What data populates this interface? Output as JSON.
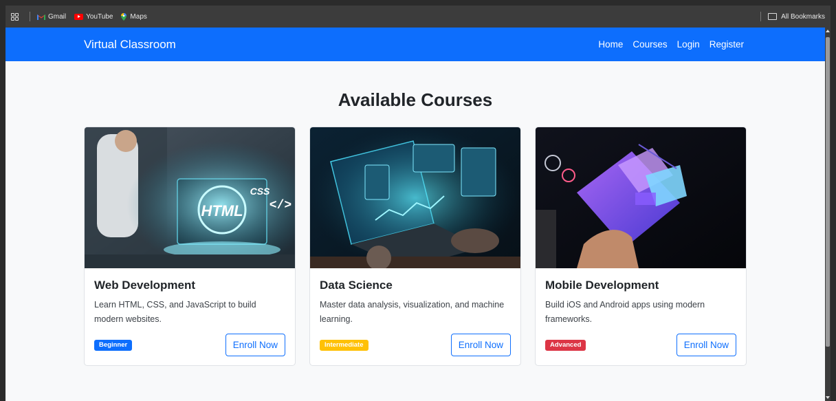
{
  "bookmarks": {
    "items": [
      {
        "label": "Gmail",
        "icon": "gmail-icon"
      },
      {
        "label": "YouTube",
        "icon": "youtube-icon"
      },
      {
        "label": "Maps",
        "icon": "maps-icon"
      }
    ],
    "all_bookmarks": "All Bookmarks"
  },
  "navbar": {
    "brand": "Virtual Classroom",
    "links": [
      "Home",
      "Courses",
      "Login",
      "Register"
    ],
    "color": "#0d6efd"
  },
  "main": {
    "title": "Available Courses",
    "courses": [
      {
        "title": "Web Development",
        "description": "Learn HTML, CSS, and JavaScript to build modern websites.",
        "level": "Beginner",
        "level_color": "#0d6efd",
        "button": "Enroll Now",
        "image": "laptop with HTML and CSS holograms"
      },
      {
        "title": "Data Science",
        "description": "Master data analysis, visualization, and machine learning.",
        "level": "Intermediate",
        "level_color": "#ffc107",
        "button": "Enroll Now",
        "image": "laptop with holographic data dashboards"
      },
      {
        "title": "Mobile Development",
        "description": "Build iOS and Android apps using modern frameworks.",
        "level": "Advanced",
        "level_color": "#dc3545",
        "button": "Enroll Now",
        "image": "hand holding phone with holographic app screens"
      }
    ]
  }
}
